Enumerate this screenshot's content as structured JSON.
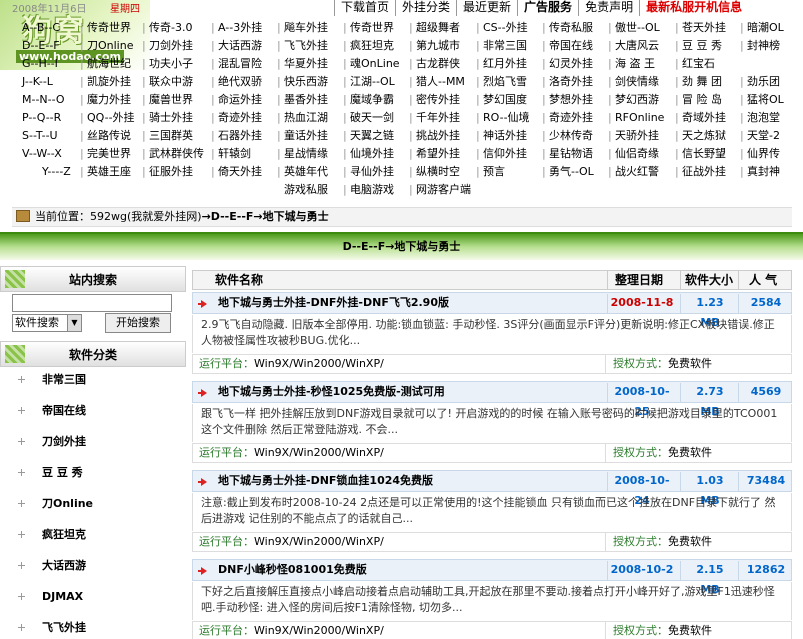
{
  "header": {
    "logo_text": "狗窝",
    "logo_url": "www.hodao.com",
    "date": "2008年11月6日",
    "weekday": "星期四",
    "nav": [
      "下载首页",
      "外挂分类",
      "最近更新",
      "广告服务",
      "免责声明",
      "最新私服开机信息"
    ]
  },
  "link_rows": [
    [
      "A--B--C",
      "传奇世界",
      "传奇-3.0",
      "A--3外挂",
      "飚车外挂",
      "传奇世界",
      "超级舞者",
      "CS--外挂",
      "传奇私服",
      "傲世--OL",
      "苍天外挂",
      "暗潮OL"
    ],
    [
      "D--E--F",
      "刀Online",
      "刀剑外挂",
      "大话西游",
      "飞飞外挂",
      "疯狂坦克",
      "第九城市",
      "非常三国",
      "帝国在线",
      "大唐风云",
      "豆 豆 秀",
      "封神榜"
    ],
    [
      "G--H--I",
      "航海世纪",
      "功夫小子",
      "混乱冒险",
      "华夏外挂",
      "魂OnLine",
      "古龙群侠",
      "红月外挂",
      "幻灵外挂",
      "海 盗 王",
      "红宝石"
    ],
    [
      "J--K--L",
      "凯旋外挂",
      "联众中游",
      "绝代双骄",
      "快乐西游",
      "江湖--OL",
      "猎人--MM",
      "烈焰飞雪",
      "洛奇外挂",
      "剑侠情缘",
      "劲 舞 团",
      "劲乐团"
    ],
    [
      "M--N--O",
      "魔力外挂",
      "魔兽世界",
      "命运外挂",
      "墨香外挂",
      "魔域争霸",
      "密传外挂",
      "梦幻国度",
      "梦想外挂",
      "梦幻西游",
      "冒 险 岛",
      "猛将OL"
    ],
    [
      "P--Q--R",
      "QQ--外挂",
      "骑士外挂",
      "奇迹外挂",
      "热血江湖",
      "破天一剑",
      "千年外挂",
      "RO--仙境",
      "奇迹外挂",
      "RFOnline",
      "奇域外挂",
      "泡泡堂"
    ],
    [
      "S--T--U",
      "丝路传说",
      "三国群英",
      "石器外挂",
      "童话外挂",
      "天翼之链",
      "挑战外挂",
      "神话外挂",
      "少林传奇",
      "天骄外挂",
      "天之炼狱",
      "天堂-2"
    ],
    [
      "V--W--X",
      "完美世界",
      "武林群侠传",
      "轩辕剑",
      "星战情缘",
      "仙境外挂",
      "希望外挂",
      "信仰外挂",
      "星钻物语",
      "仙侣奇缘",
      "信长野望",
      "仙界传"
    ],
    [
      "Y----Z",
      "英雄王座",
      "征服外挂",
      "倚天外挂",
      "英雄年代",
      "寻仙外挂",
      "纵横时空",
      "预言",
      "勇气--OL",
      "战火红警",
      "征战外挂",
      "真封神"
    ],
    [
      "游戏私服",
      "电脑游戏",
      "网游客户端"
    ]
  ],
  "breadcrumb": {
    "label": "当前位置：",
    "site": "592wg(我就爱外挂网)",
    "path": "→D--E--F→地下城与勇士"
  },
  "title_bar": "D--E--F→地下城与勇士",
  "sidebar": {
    "search_title": "站内搜索",
    "search_value": "",
    "search_select": "软件搜索",
    "search_button": "开始搜索",
    "category_title": "软件分类",
    "categories": [
      "非常三国",
      "帝国在线",
      "刀剑外挂",
      "豆 豆 秀",
      "刀Online",
      "疯狂坦克",
      "大话西游",
      "DJMAX",
      "飞飞外挂"
    ]
  },
  "list": {
    "headers": {
      "name": "软件名称",
      "date": "整理日期",
      "size": "软件大小",
      "popularity": "人 气"
    },
    "platform_label": "运行平台：",
    "auth_label": "授权方式：",
    "entries": [
      {
        "name": "地下城与勇士外挂-DNF外挂-DNF飞飞2.90版",
        "date": "2008-11-8",
        "date_new": true,
        "size": "1.23 MB",
        "pop": "2584",
        "desc": "2.9飞飞自动隐藏. 旧版本全部停用. 功能:锁血锁蓝: 手动秒怪. 3S评分(画面显示F评分)更新说明:修正CX板块错误.修正人物被怪属性攻被秒BUG.优化...",
        "platform": "Win9X/Win2000/WinXP/",
        "auth": "免费软件"
      },
      {
        "name": "地下城与勇士外挂-秒怪1025免费版-测试可用",
        "date": "2008-10-25",
        "date_new": false,
        "size": "2.73 MB",
        "pop": "4569",
        "desc": "跟飞飞一样 把外挂解压放到DNF游戏目录就可以了! 开启游戏的的时候 在输入账号密码的时候把游戏目录里的TCO001这个文件删除 然后正常登陆游戏. 不会...",
        "platform": "Win9X/Win2000/WinXP/",
        "auth": "免费软件"
      },
      {
        "name": "地下城与勇士外挂-DNF锁血挂1024免费版",
        "date": "2008-10-24",
        "date_new": false,
        "size": "1.03 MB",
        "pop": "73484",
        "desc": "注意:截止到发布时2008-10-24 2点还是可以正常使用的!这个挂能锁血 只有锁血而已这个挂放在DNF目录下就行了 然后进游戏 记住别的不能点点了的话就自己...",
        "platform": "Win9X/Win2000/WinXP/",
        "auth": "免费软件"
      },
      {
        "name": "DNF小峰秒怪081001免费版",
        "date": "2008-10-2",
        "date_new": false,
        "size": "2.15 MB",
        "pop": "12862",
        "desc": "下好之后直接解压直接点小峰启动接着点启动辅助工具,开起放在那里不要动.接着点打开小峰开好了,游戏里F1迅速秒怪吧.手动秒怪: 进入怪的房间后按F1清除怪物, 切勿多...",
        "platform": "Win9X/Win2000/WinXP/",
        "auth": "免费软件"
      }
    ]
  }
}
